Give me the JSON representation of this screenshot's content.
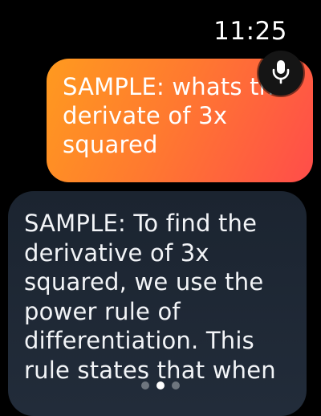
{
  "status": {
    "time": "11:25"
  },
  "messages": {
    "user": "SAMPLE: whats the derivate of 3x squared",
    "assistant": "SAMPLE: To find the derivative of 3x squared, we use the power rule of differentiation. This rule states that when"
  },
  "controls": {
    "mic_icon": "microphone-icon"
  },
  "pagination": {
    "pages": 3,
    "active_index": 1
  },
  "colors": {
    "background": "#000000",
    "user_bubble_start": "#ff9a1f",
    "user_bubble_end": "#ff4d4a",
    "assistant_bubble": "#1f2835",
    "mic_button": "#151515"
  }
}
